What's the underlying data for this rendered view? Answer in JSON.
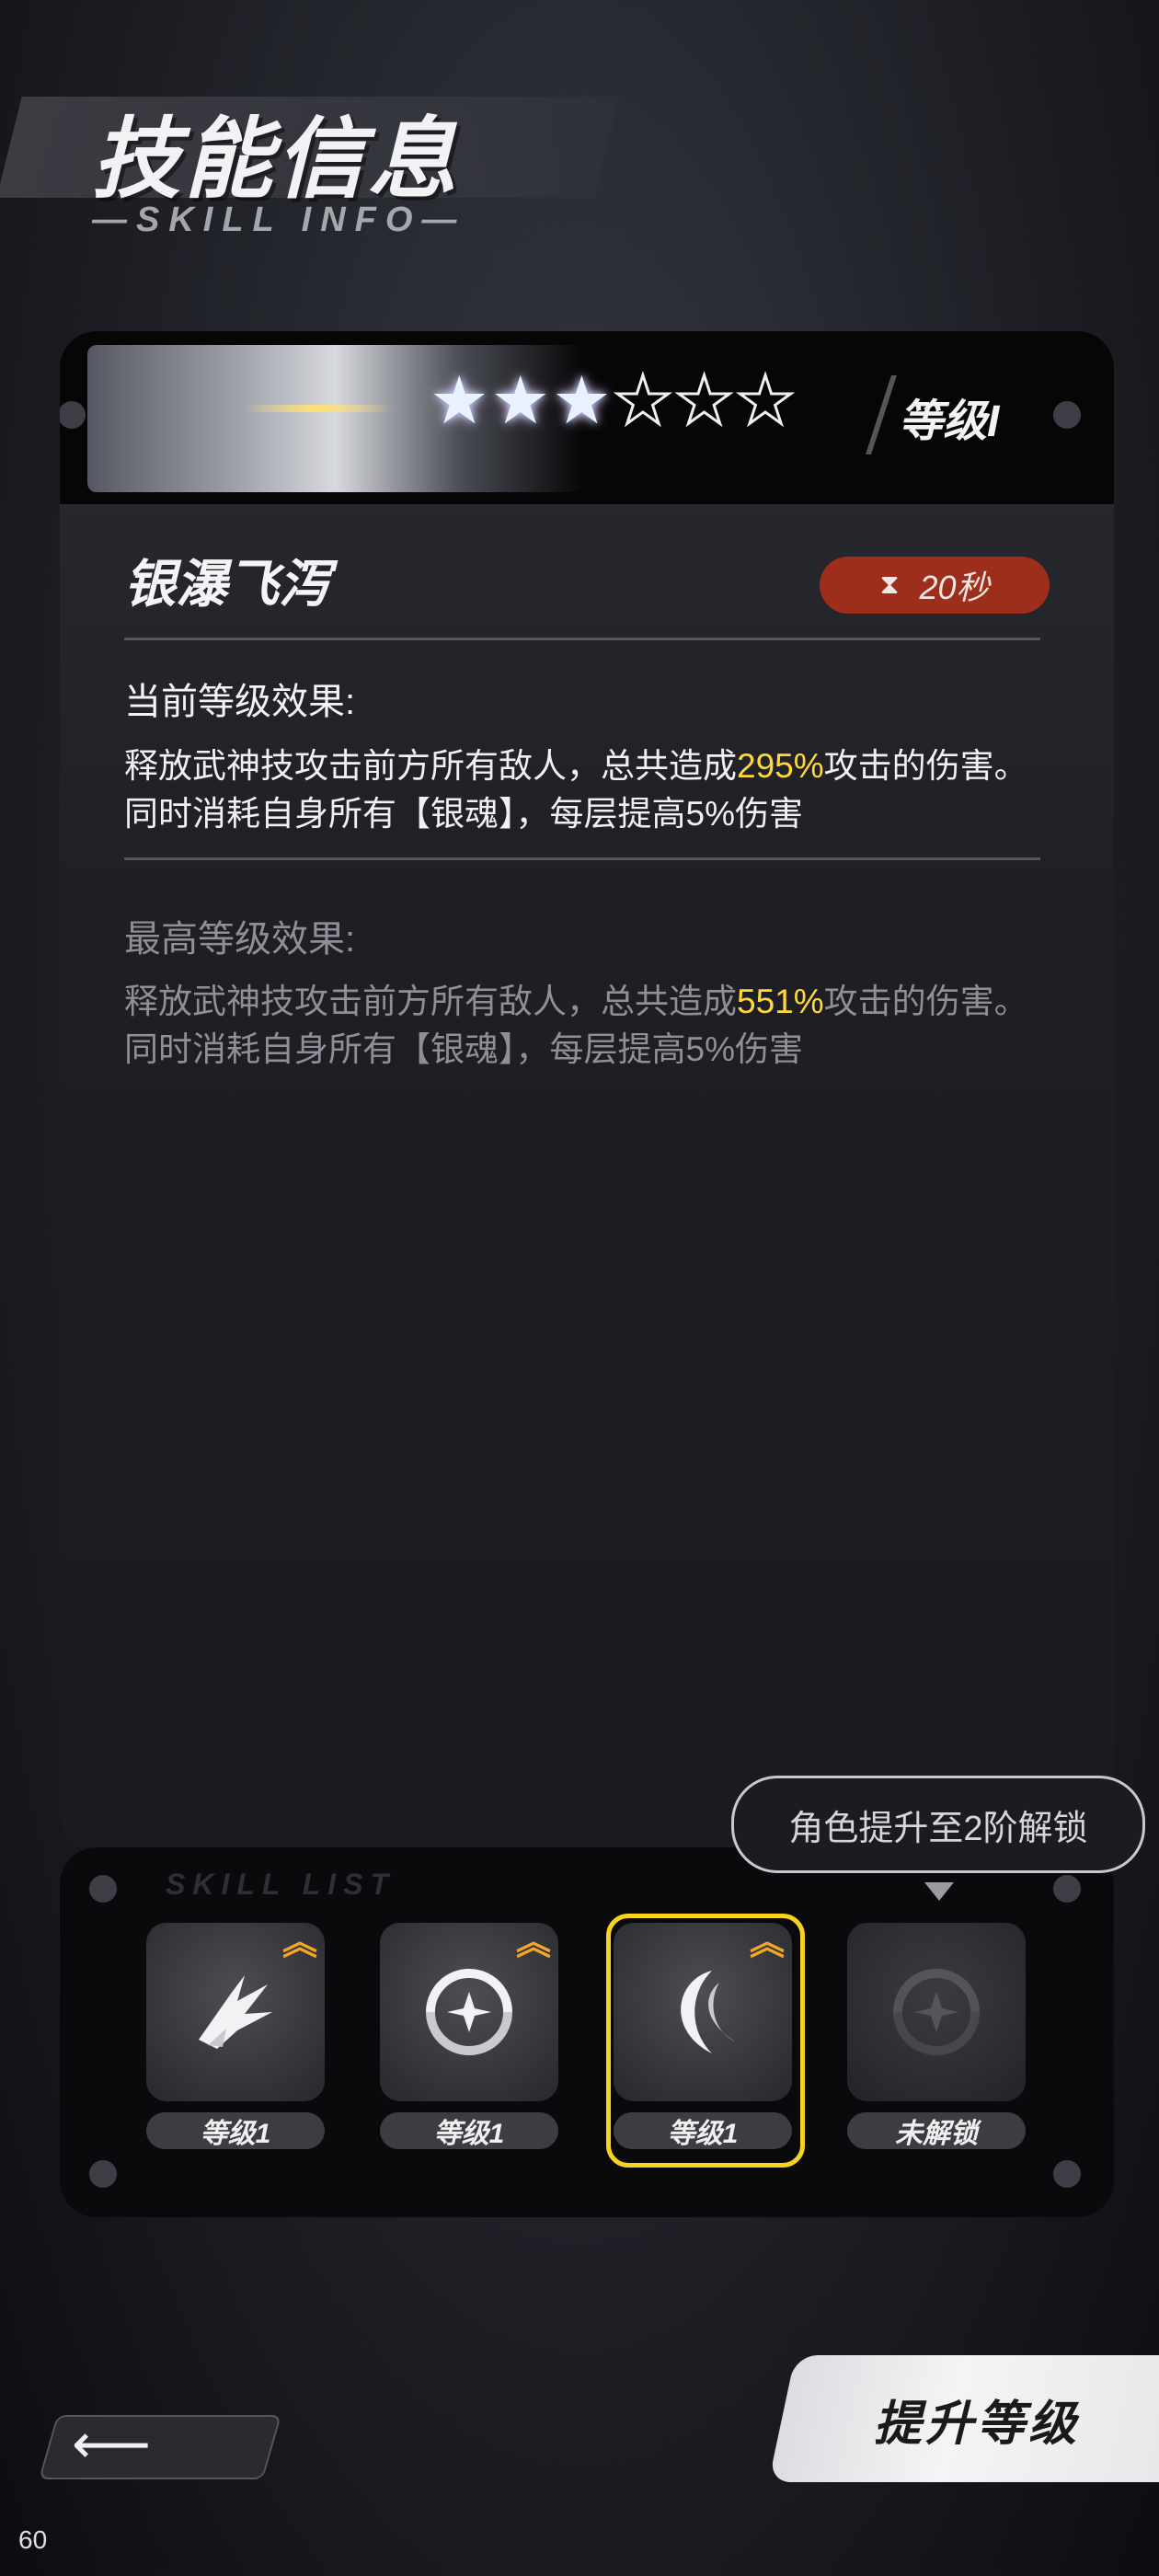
{
  "header": {
    "title": "技能信息",
    "subtitle": "—SKILL INFO—"
  },
  "skill": {
    "stars_filled": 3,
    "stars_total": 6,
    "level_label": "等级I",
    "name": "银瀑飞泻",
    "cooldown": "20秒",
    "current": {
      "label": "当前等级效果:",
      "text_before": "释放武神技攻击前方所有敌人，总共造成",
      "value": "295%",
      "text_after": "攻击的伤害。同时消耗自身所有【银魂】，每层提高5%伤害"
    },
    "max": {
      "label": "最高等级效果:",
      "text_before": "释放武神技攻击前方所有敌人，总共造成",
      "value": "551%",
      "text_after": "攻击的伤害。同时消耗自身所有【银魂】，每层提高5%伤害"
    }
  },
  "skill_list": {
    "watermark": "SKILL LIST",
    "tooltip": "角色提升至2阶解锁",
    "slots": [
      {
        "level": "等级1",
        "upgradable": true,
        "selected": false,
        "icon": "beast-claw-icon"
      },
      {
        "level": "等级1",
        "upgradable": true,
        "selected": false,
        "icon": "shuriken-icon"
      },
      {
        "level": "等级1",
        "upgradable": true,
        "selected": true,
        "icon": "crescent-slash-icon"
      },
      {
        "level": "未解锁",
        "upgradable": false,
        "selected": false,
        "icon": "locked-shuriken-icon"
      }
    ]
  },
  "controls": {
    "upgrade_label": "提升等级",
    "back_icon": "arrow-left-icon"
  },
  "corner_number": "60",
  "colors": {
    "highlight": "#ffd93a",
    "cooldown_badge": "#9c2e1b",
    "selected_frame": "#f7d21e",
    "upgrade_arrow": "#f5a623"
  }
}
